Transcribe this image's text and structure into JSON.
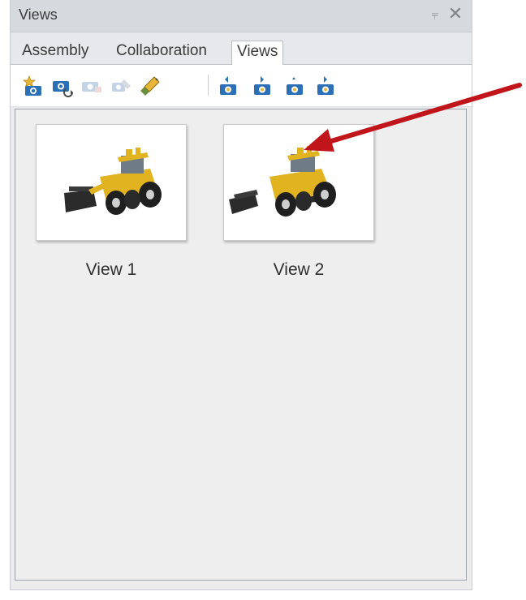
{
  "panel": {
    "title": "Views",
    "pin_glyph": "⫧",
    "close_glyph": "✕"
  },
  "tabs": [
    {
      "label": "Assembly",
      "active": false
    },
    {
      "label": "Collaboration",
      "active": false
    },
    {
      "label": "Views",
      "active": true
    }
  ],
  "toolbar": {
    "icons": [
      "new-view-icon",
      "update-view-icon",
      "delete-view-icon",
      "view-properties-icon",
      "clean-views-icon",
      "move-view-first-icon",
      "move-view-previous-icon",
      "move-view-next-icon",
      "move-view-last-icon"
    ]
  },
  "views": [
    {
      "label": "View 1"
    },
    {
      "label": "View 2"
    }
  ],
  "annotation": {
    "arrow_color": "#c0161b",
    "points_to": "View 2"
  },
  "colors": {
    "vehicle_yellow": "#e2b320",
    "vehicle_black": "#2b2b2b",
    "toolbar_blue": "#2b6fb6",
    "toolbar_gold": "#e8b73a"
  }
}
